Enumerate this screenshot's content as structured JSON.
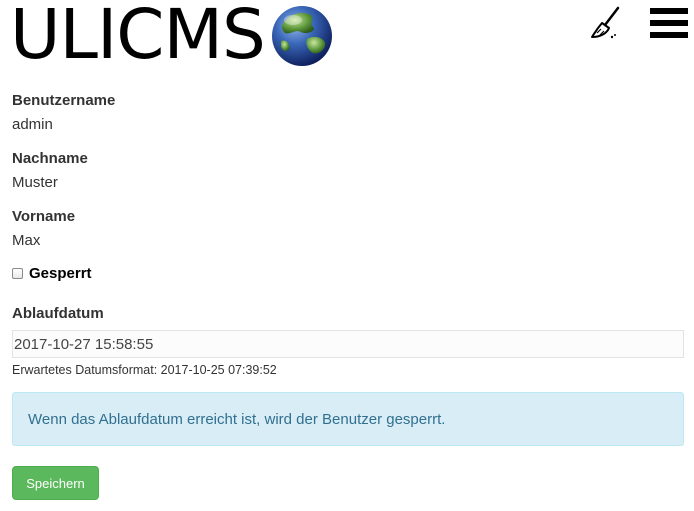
{
  "header": {
    "brand_text": "ULICMS",
    "logo_icon": "globe-icon",
    "clear_cache_icon": "broom-icon",
    "menu_icon": "hamburger-menu-icon"
  },
  "form": {
    "username": {
      "label": "Benutzername",
      "value": "admin"
    },
    "lastname": {
      "label": "Nachname",
      "value": "Muster"
    },
    "firstname": {
      "label": "Vorname",
      "value": "Max"
    },
    "locked": {
      "label": "Gesperrt",
      "checked": false
    },
    "expiry": {
      "label": "Ablaufdatum",
      "value": "2017-10-27 15:58:55",
      "hint": "Erwartetes Datumsformat: 2017-10-25 07:39:52"
    },
    "info_message": "Wenn das Ablaufdatum erreicht ist, wird der Benutzer gesperrt.",
    "save_label": "Speichern"
  },
  "colors": {
    "save_button": "#5cb85c",
    "alert_background": "#d9edf7",
    "alert_text": "#31708f"
  }
}
